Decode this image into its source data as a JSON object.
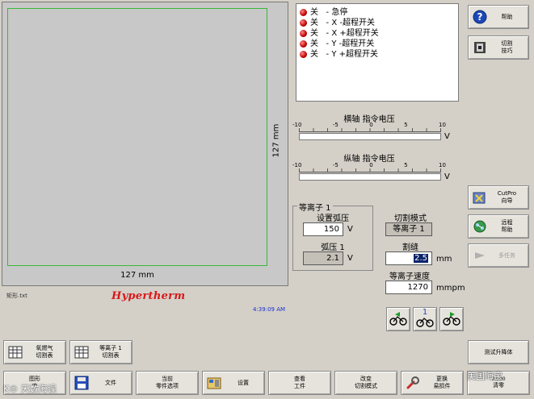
{
  "preview": {
    "width_label": "127 mm",
    "height_label": "127 mm",
    "file_name": "矩形.txt",
    "brand": "Hypertherm",
    "time": "4:39:09 AM"
  },
  "status_items": [
    {
      "state": "关",
      "label": "- 急停"
    },
    {
      "state": "关",
      "label": "- X -超程开关"
    },
    {
      "state": "关",
      "label": "- X +超程开关"
    },
    {
      "state": "关",
      "label": "- Y -超程开关"
    },
    {
      "state": "关",
      "label": "- Y +超程开关"
    }
  ],
  "x_axis_meter": {
    "title": "横轴 指令电压",
    "scale": [
      "-10",
      "-5",
      "0",
      "5",
      "10"
    ],
    "unit": "V",
    "value": 0
  },
  "y_axis_meter": {
    "title": "纵轴 指令电压",
    "scale": [
      "-10",
      "-5",
      "0",
      "5",
      "10"
    ],
    "unit": "V",
    "value": 0
  },
  "plasma": {
    "group_title": "等离子 1",
    "arc_voltage_label": "设置弧压",
    "arc_voltage_value": "150",
    "arc_voltage_unit": "V",
    "arc_label": "弧压 1",
    "arc_value": "2.1",
    "arc_unit": "V"
  },
  "cut": {
    "mode_label": "切割模式",
    "mode_value": "等离子 1",
    "kerf_label": "割缝",
    "kerf_value": "2.5",
    "kerf_unit": "mm",
    "speed_label": "等离子速度",
    "speed_value": "1270",
    "speed_unit": "mmpm"
  },
  "side_buttons": {
    "help": "帮助",
    "cut_tips": "切割\n技巧",
    "cutpro": "CutPro\n向导",
    "remote_help": "远程\n帮助",
    "task": "多任务",
    "test_lifter": "测试升降体"
  },
  "motion_buttons": {
    "step_label": "1"
  },
  "toolbar_top": {
    "oxy_table": "氧燃气\n切割表",
    "plasma_table": "等离子 1\n切割表"
  },
  "toolbar_bottom": {
    "shapes": "图形\n库",
    "files": "文件",
    "part_options": "当前\n零件选项",
    "setup": "设置",
    "view_part": "查看\n工件",
    "change_mode": "改变\n切割模式",
    "consumables": "更换\n易损件",
    "consumables_count": "0.000",
    "clear": "清零"
  },
  "watermarks": {
    "left": "K© 天数海误",
    "right": "美国海宝"
  },
  "colors": {
    "led_red": "#c00000",
    "brand_red": "#d81818",
    "time_blue": "#1a2fcf",
    "selection_navy": "#0a246a",
    "preview_green": "#38b838"
  }
}
